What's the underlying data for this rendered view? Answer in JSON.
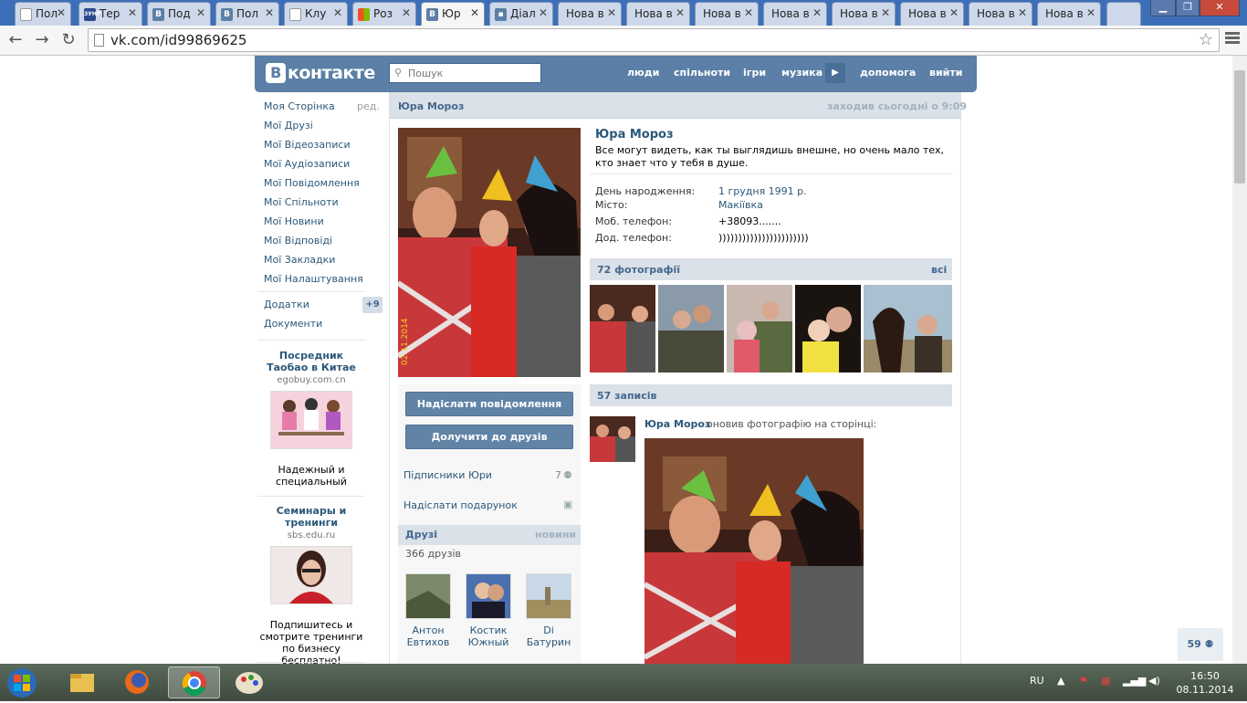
{
  "browser": {
    "tabs": [
      {
        "label": "Пол",
        "icon": "page-icon"
      },
      {
        "label": "Тер",
        "icon": "zunr-icon"
      },
      {
        "label": "Под",
        "icon": "vk-icon"
      },
      {
        "label": "Пол",
        "icon": "vk-icon"
      },
      {
        "label": "Клу",
        "icon": "page-icon"
      },
      {
        "label": "Роз",
        "icon": "windows-icon"
      },
      {
        "label": "Юр",
        "icon": "vk-icon"
      },
      {
        "label": "Діал",
        "icon": "chat-icon"
      },
      {
        "label": "Нова в",
        "icon": ""
      },
      {
        "label": "Нова в",
        "icon": ""
      },
      {
        "label": "Нова в",
        "icon": ""
      },
      {
        "label": "Нова в",
        "icon": ""
      },
      {
        "label": "Нова в",
        "icon": ""
      },
      {
        "label": "Нова в",
        "icon": ""
      },
      {
        "label": "Нова в",
        "icon": ""
      },
      {
        "label": "Нова в",
        "icon": ""
      }
    ],
    "url": "vk.com/id99869625"
  },
  "header": {
    "logo": "контакте",
    "logo_letter": "В",
    "search_placeholder": "Пошук",
    "links": [
      "люди",
      "спільноти",
      "ігри",
      "музика",
      "допомога",
      "вийти"
    ]
  },
  "left_menu": {
    "items": [
      "Моя Сторінка",
      "Мої Друзі",
      "Мої Відеозаписи",
      "Мої Аудіозаписи",
      "Мої Повідомлення",
      "Мої Спільноти",
      "Мої Новини",
      "Мої Відповіді",
      "Мої Закладки",
      "Мої Налаштування"
    ],
    "edit": "ред.",
    "apps": "Додатки",
    "apps_count": "+9",
    "docs": "Документи"
  },
  "ads": [
    {
      "title": "Посредник Таобао в Китае",
      "domain": "egobuy.com.cn",
      "text": "Надежный и специальный"
    },
    {
      "title": "Семинары и тренинги",
      "domain": "sbs.edu.ru",
      "text": "Подпишитесь и смотрите тренинги по бизнесу бесплатно!"
    }
  ],
  "profile": {
    "name_bar": "Юра Мороз",
    "last_seen": "заходив сьогодні о 9:09",
    "name": "Юра Мороз",
    "status": "Все могут видеть, как ты выглядишь внешне, но очень мало тех, кто знает что у тебя в душе.",
    "info": [
      {
        "k": "День народження:",
        "v": "1 грудня 1991 р."
      },
      {
        "k": "Місто:",
        "v": "Макіївка"
      },
      {
        "k": "Моб. телефон:",
        "v": "+38093......."
      },
      {
        "k": "Дод. телефон:",
        "v": ")))))))))))))))))))))))"
      }
    ],
    "photo_date": "02.11.2014"
  },
  "actions": {
    "send_message": "Надіслати повідомлення",
    "add_friend": "Долучити до друзів",
    "subscribers": "Підписники Юри",
    "subscribers_count": "7",
    "send_gift": "Надіслати подарунок"
  },
  "friends": {
    "title": "Друзі",
    "updates": "новини",
    "count": "366 друзів",
    "list": [
      {
        "first": "Антон",
        "last": "Евтихов"
      },
      {
        "first": "Костик",
        "last": "Южный"
      },
      {
        "first": "Di",
        "last": "Батурин"
      }
    ]
  },
  "photos": {
    "title": "72 фотографії",
    "all": "всі"
  },
  "wall": {
    "title": "57 записів",
    "post_author": "Юра Мороз",
    "post_text": "оновив фотографію на сторінці:"
  },
  "online_count": "59",
  "taskbar": {
    "lang": "RU",
    "time": "16:50",
    "date": "08.11.2014"
  },
  "colors": {
    "vk_header": "#5b7fa6",
    "link": "#2b587a",
    "bar": "#dae1e8"
  }
}
